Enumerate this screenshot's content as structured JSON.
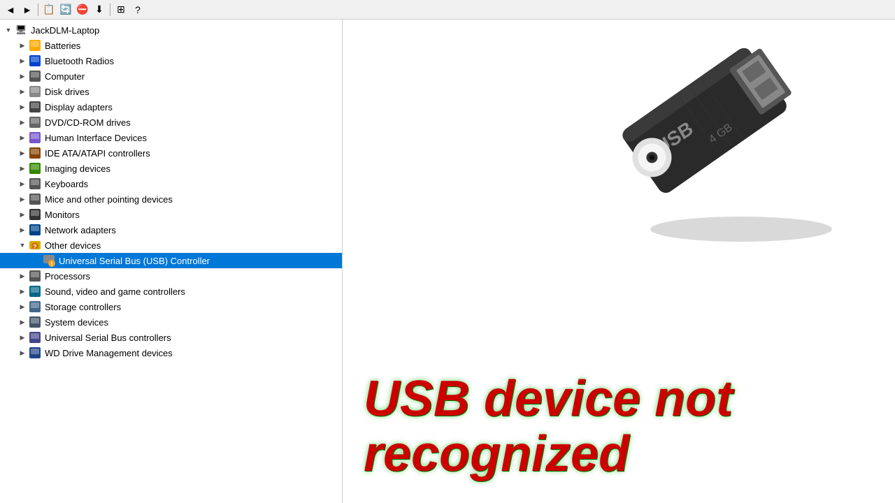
{
  "toolbar": {
    "buttons": [
      "◄",
      "►",
      "⬜",
      "📋",
      "🔄",
      "⛔",
      "⬇"
    ]
  },
  "tree": {
    "root": {
      "label": "JackDLM-Laptop",
      "icon": "💻",
      "expanded": true
    },
    "items": [
      {
        "id": "batteries",
        "label": "Batteries",
        "icon": "🔋",
        "indent": 1,
        "expanded": false,
        "type": "group"
      },
      {
        "id": "bluetooth",
        "label": "Bluetooth Radios",
        "icon": "🔵",
        "indent": 1,
        "expanded": false,
        "type": "group"
      },
      {
        "id": "computer",
        "label": "Computer",
        "icon": "🖥",
        "indent": 1,
        "expanded": false,
        "type": "group"
      },
      {
        "id": "disk",
        "label": "Disk drives",
        "icon": "💽",
        "indent": 1,
        "expanded": false,
        "type": "group"
      },
      {
        "id": "display",
        "label": "Display adapters",
        "icon": "🖵",
        "indent": 1,
        "expanded": false,
        "type": "group"
      },
      {
        "id": "dvd",
        "label": "DVD/CD-ROM drives",
        "icon": "💿",
        "indent": 1,
        "expanded": false,
        "type": "group"
      },
      {
        "id": "hid",
        "label": "Human Interface Devices",
        "icon": "🎮",
        "indent": 1,
        "expanded": false,
        "type": "group"
      },
      {
        "id": "ide",
        "label": "IDE ATA/ATAPI controllers",
        "icon": "🔌",
        "indent": 1,
        "expanded": false,
        "type": "group"
      },
      {
        "id": "imaging",
        "label": "Imaging devices",
        "icon": "📷",
        "indent": 1,
        "expanded": false,
        "type": "group"
      },
      {
        "id": "keyboards",
        "label": "Keyboards",
        "icon": "⌨",
        "indent": 1,
        "expanded": false,
        "type": "group"
      },
      {
        "id": "mice",
        "label": "Mice and other pointing devices",
        "icon": "🖱",
        "indent": 1,
        "expanded": false,
        "type": "group"
      },
      {
        "id": "monitors",
        "label": "Monitors",
        "icon": "🖥",
        "indent": 1,
        "expanded": false,
        "type": "group"
      },
      {
        "id": "network",
        "label": "Network adapters",
        "icon": "🌐",
        "indent": 1,
        "expanded": false,
        "type": "group"
      },
      {
        "id": "other",
        "label": "Other devices",
        "icon": "❓",
        "indent": 1,
        "expanded": true,
        "type": "group",
        "hasWarning": false
      },
      {
        "id": "usb-controller",
        "label": "Universal Serial Bus (USB) Controller",
        "icon": "⚠",
        "indent": 2,
        "expanded": false,
        "type": "device",
        "selected": true,
        "hasWarning": true
      },
      {
        "id": "processors",
        "label": "Processors",
        "icon": "⚙",
        "indent": 1,
        "expanded": false,
        "type": "group"
      },
      {
        "id": "sound",
        "label": "Sound, video and game controllers",
        "icon": "🔊",
        "indent": 1,
        "expanded": false,
        "type": "group"
      },
      {
        "id": "storage",
        "label": "Storage controllers",
        "icon": "💾",
        "indent": 1,
        "expanded": false,
        "type": "group"
      },
      {
        "id": "system",
        "label": "System devices",
        "icon": "🔧",
        "indent": 1,
        "expanded": false,
        "type": "group"
      },
      {
        "id": "usb-controllers",
        "label": "Universal Serial Bus controllers",
        "icon": "🔌",
        "indent": 1,
        "expanded": false,
        "type": "group"
      },
      {
        "id": "wd",
        "label": "WD Drive Management devices",
        "icon": "💽",
        "indent": 1,
        "expanded": false,
        "type": "group"
      }
    ]
  },
  "error_message": {
    "line1": "USB device not",
    "line2": "recognized"
  }
}
